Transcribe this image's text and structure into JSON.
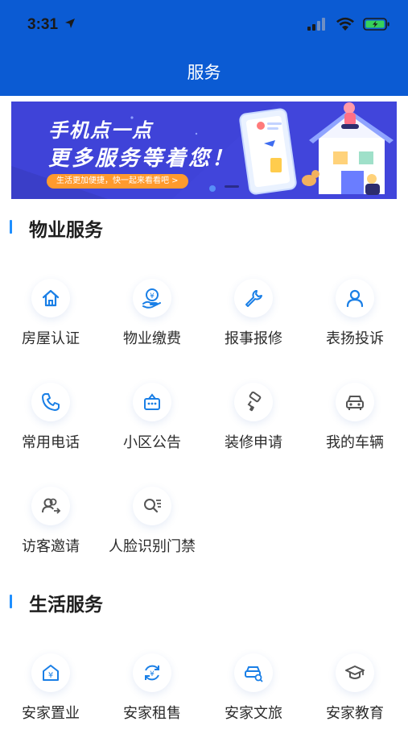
{
  "status_bar": {
    "time": "3:31"
  },
  "header": {
    "title": "服务"
  },
  "banner": {
    "line1": "手机点一点",
    "line2": "更多服务等着您！",
    "pill": "生活更加便捷，快一起来看看吧 >"
  },
  "sections": {
    "property": {
      "title": "物业服务",
      "items": [
        {
          "label": "房屋认证",
          "icon": "house-icon"
        },
        {
          "label": "物业缴费",
          "icon": "payment-icon"
        },
        {
          "label": "报事报修",
          "icon": "wrench-icon"
        },
        {
          "label": "表扬投诉",
          "icon": "person-icon"
        },
        {
          "label": "常用电话",
          "icon": "phone-icon"
        },
        {
          "label": "小区公告",
          "icon": "announcement-icon"
        },
        {
          "label": "装修申请",
          "icon": "paint-roller-icon"
        },
        {
          "label": "我的车辆",
          "icon": "car-icon"
        },
        {
          "label": "访客邀请",
          "icon": "visitor-icon"
        },
        {
          "label": "人脸识别门禁",
          "icon": "face-search-icon"
        }
      ]
    },
    "life": {
      "title": "生活服务",
      "items": [
        {
          "label": "安家置业",
          "icon": "property-sale-icon"
        },
        {
          "label": "安家租售",
          "icon": "rent-exchange-icon"
        },
        {
          "label": "安家文旅",
          "icon": "travel-car-icon"
        },
        {
          "label": "安家教育",
          "icon": "graduation-cap-icon"
        }
      ]
    }
  },
  "colors": {
    "header": "#0b5bd3",
    "accent": "#1f8fff",
    "banner": "#3f43d8",
    "icon": "#1a7fe6"
  }
}
